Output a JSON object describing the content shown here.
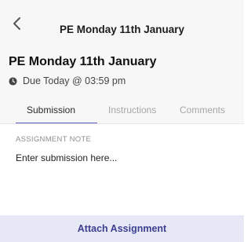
{
  "navbar": {
    "back_icon": "chevron-left-icon",
    "title": "PE Monday 11th January"
  },
  "assignment": {
    "title": "PE Monday 11th January",
    "due_icon": "clock-icon",
    "due_text": "Due Today @ 03:59 pm"
  },
  "tabs": [
    {
      "label": "Submission",
      "active": true
    },
    {
      "label": "Instructions",
      "active": false
    },
    {
      "label": "Comments",
      "active": false
    }
  ],
  "submission": {
    "note_label": "ASSIGNMENT NOTE",
    "note_placeholder": "Enter submission here...",
    "note_value": ""
  },
  "actions": {
    "attach_label": "Attach Assignment"
  },
  "colors": {
    "accent": "#5a5fbf",
    "header_bg": "#f7f7f8",
    "button_bg": "#e6e8f6",
    "button_text": "#3b3f8f"
  }
}
